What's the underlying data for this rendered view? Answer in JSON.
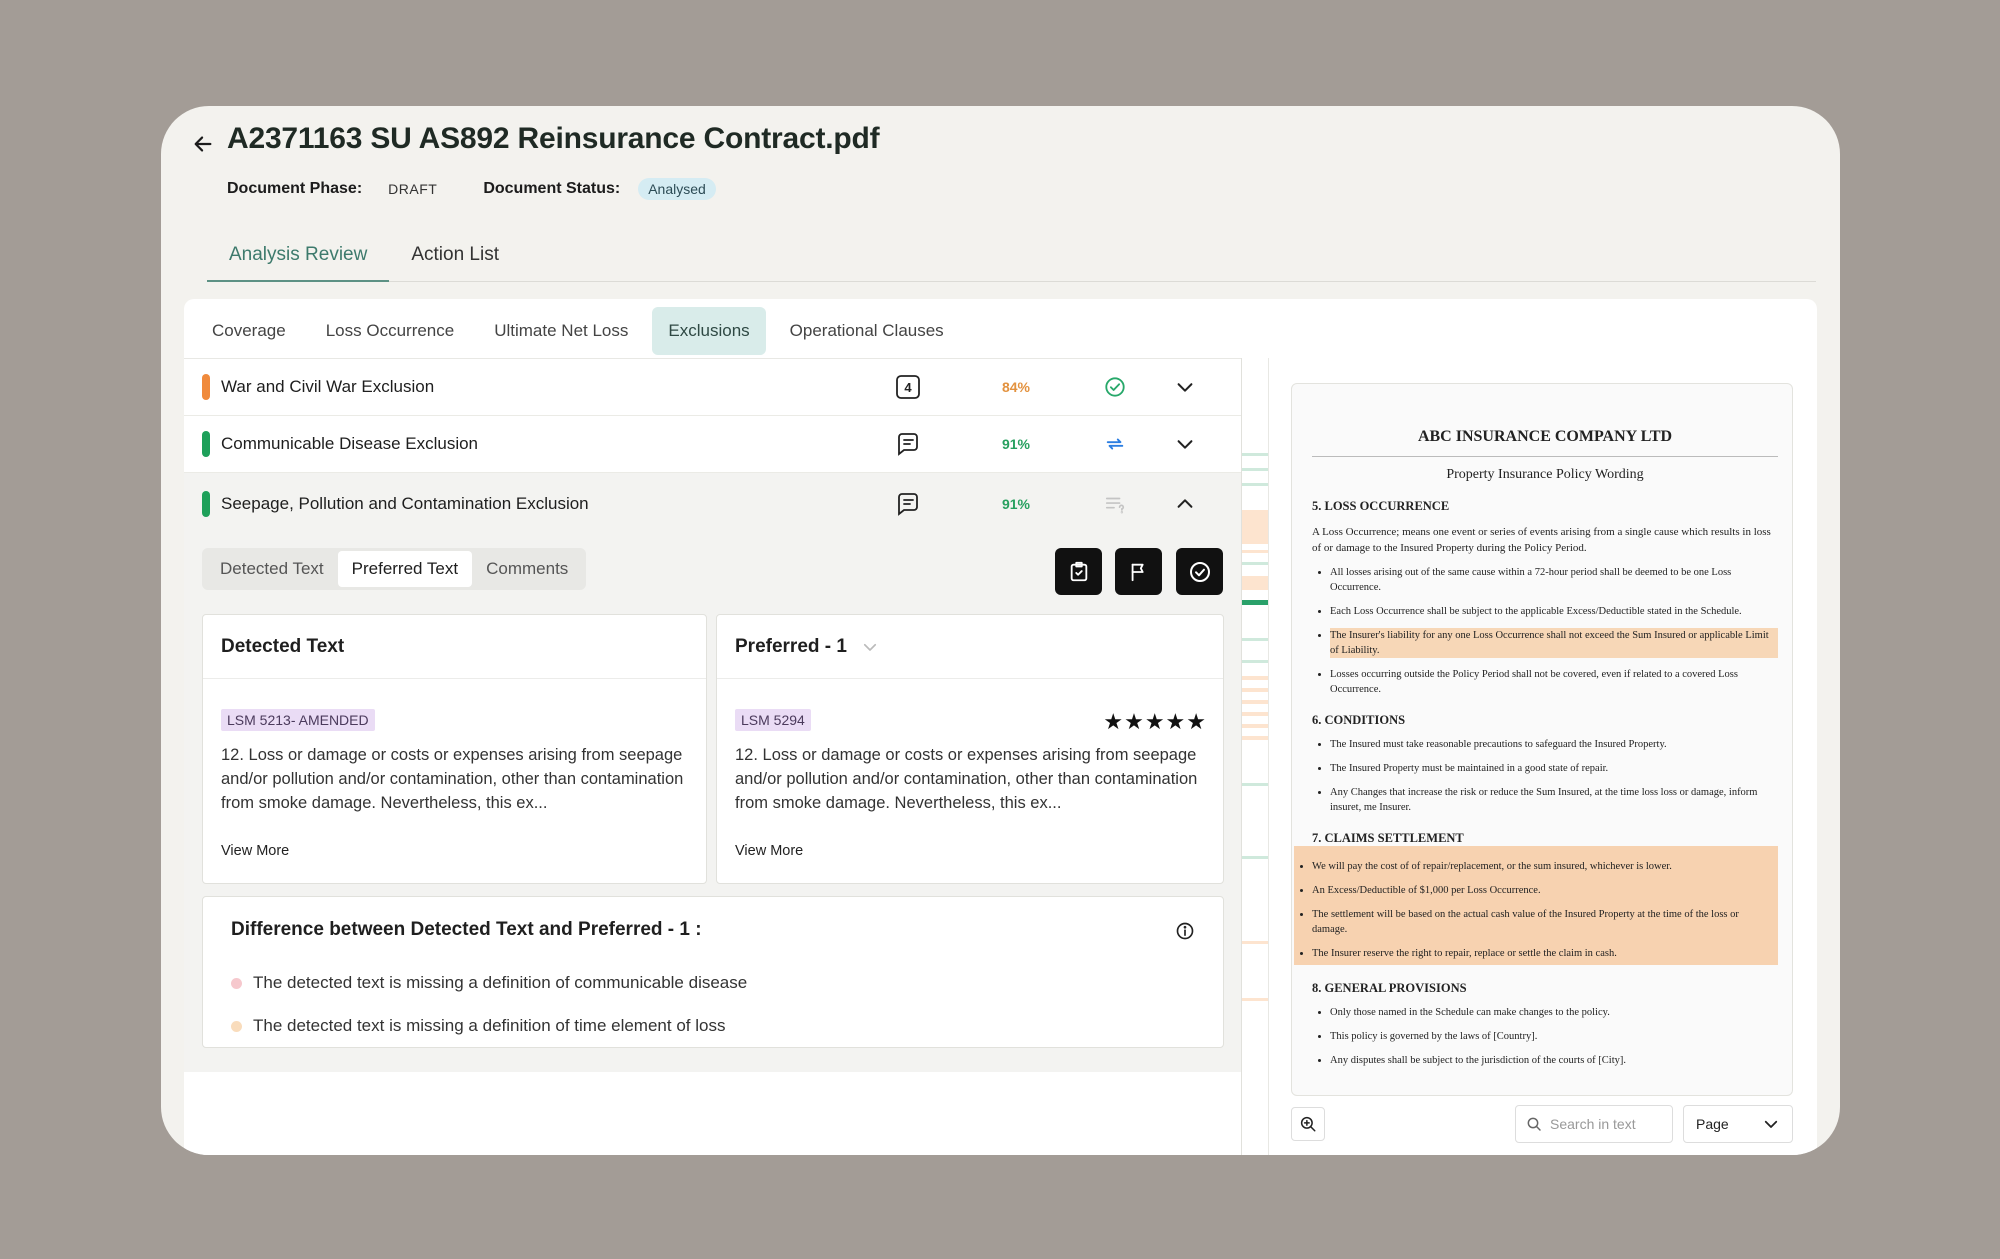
{
  "header": {
    "back_icon": "arrow-left-icon",
    "title": "A2371163 SU AS892 Reinsurance Contract.pdf",
    "phase_label": "Document Phase:",
    "phase_value": "DRAFT",
    "status_label": "Document Status:",
    "status_value": "Analysed"
  },
  "main_tabs": [
    {
      "label": "Analysis Review",
      "active": true
    },
    {
      "label": "Action List",
      "active": false
    }
  ],
  "sub_tabs": [
    {
      "label": "Coverage"
    },
    {
      "label": "Loss Occurrence"
    },
    {
      "label": "Ultimate Net Loss"
    },
    {
      "label": "Exclusions",
      "active": true
    },
    {
      "label": "Operational Clauses"
    }
  ],
  "clauses": [
    {
      "name": "War and Civil War Exclusion",
      "bar_color": "#f08a3c",
      "count": "4",
      "score": "84%",
      "score_color": "#e3923f",
      "status": "check-circle-icon",
      "expanded": false
    },
    {
      "name": "Communicable Disease Exclusion",
      "bar_color": "#1ea05a",
      "count": "",
      "score": "91%",
      "score_color": "#27a05f",
      "status": "sync-icon",
      "expanded": false
    },
    {
      "name": "Seepage, Pollution and Contamination Exclusion",
      "bar_color": "#1ea05a",
      "count": "",
      "score": "91%",
      "score_color": "#27a05f",
      "status": "list-question-icon",
      "expanded": true
    }
  ],
  "detail": {
    "segments": [
      "Detected Text",
      "Preferred Text",
      "Comments"
    ],
    "active_segment": "Preferred Text",
    "detected": {
      "heading": "Detected Text",
      "tag": "LSM 5213- AMENDED",
      "text": "12. Loss or damage or costs or expenses arising from seepage and/or pollution and/or contamination, other than contamination from smoke damage. Nevertheless, this ex...",
      "view_more": "View More"
    },
    "preferred": {
      "heading": "Preferred - 1",
      "tag": "LSM 5294",
      "rating": 5,
      "stars": "★★★★★",
      "text": "12. Loss or damage or costs or expenses arising from seepage and/or pollution and/or contamination, other than contamination from smoke damage. Nevertheless, this ex...",
      "view_more": "View More"
    },
    "difference": {
      "heading": "Difference between Detected Text and Preferred - 1 :",
      "items": [
        {
          "text": "The detected text is missing a definition of communicable disease",
          "dot_color": "#f6c8cd"
        },
        {
          "text": "The detected text is missing a definition of time element of loss",
          "dot_color": "#f9dcbc"
        }
      ]
    }
  },
  "document": {
    "company": "ABC INSURANCE COMPANY LTD",
    "subtitle": "Property Insurance Policy Wording",
    "s5_title": "5. LOSS OCCURRENCE",
    "s5_intro": "A Loss Occurrence; means one event or series of events arising from a single cause which results in loss of or damage to the Insured Property during the Policy Period.",
    "s5_items": [
      "All losses arising out of the same cause within a 72-hour period shall be deemed to be one Loss Occurrence.",
      "Each Loss Occurrence shall be subject to the applicable Excess/Deductible stated in the Schedule.",
      "The Insurer's liability for any one Loss Occurrence shall not exceed the Sum Insured or applicable Limit of Liability.",
      "Losses occurring outside the Policy Period shall not be covered, even if related to a covered Loss Occurrence."
    ],
    "s6_title": "6. CONDITIONS",
    "s6_items": [
      "The Insured must take reasonable precautions to safeguard the Insured Property.",
      "The Insured Property must be maintained in a good state of repair.",
      "Any Changes that increase the risk or reduce the Sum Insured, at the time loss loss or damage, inform insuret, me Insurer."
    ],
    "s7_title": "7. CLAIMS SETTLEMENT",
    "s7_items": [
      "We will pay the cost of of repair/replacement, or the sum insured, whichever is lower.",
      "An Excess/Deductible of $1,000 per Loss Occurrence.",
      "The settlement will be based on the actual cash value of the Insured Property at the time of the loss or damage.",
      "The Insurer reserve the right to repair, replace or settle the claim in cash."
    ],
    "s8_title": "8. GENERAL PROVISIONS",
    "s8_items": [
      "Only those named in the Schedule can make changes to the policy.",
      "This policy is governed by the laws of [Country].",
      "Any disputes shall be subject to the jurisdiction of the courts of [City]."
    ]
  },
  "viewer": {
    "zoom_icon": "zoom-in-icon",
    "search_placeholder": "Search in text",
    "page_label": "Page"
  }
}
